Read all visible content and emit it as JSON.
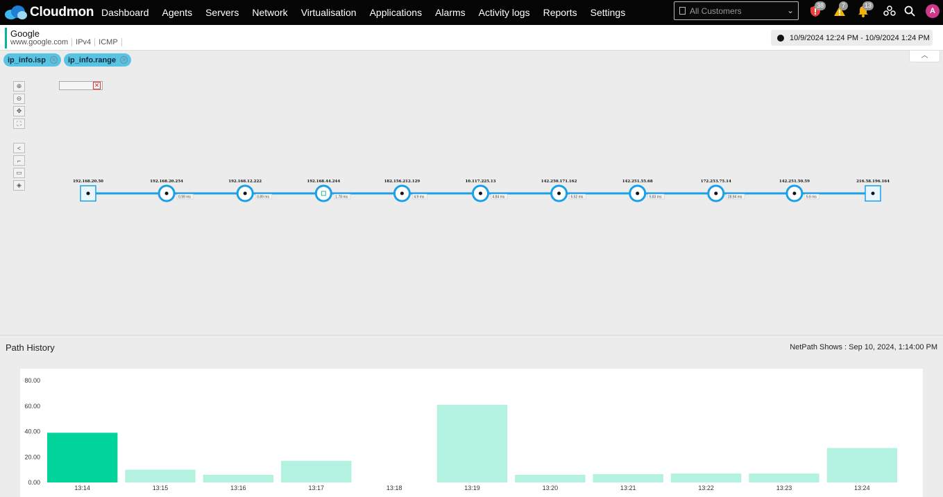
{
  "app": {
    "name": "Cloudmon",
    "nav": [
      "Dashboard",
      "Agents",
      "Servers",
      "Network",
      "Virtualisation",
      "Applications",
      "Alarms",
      "Activity logs",
      "Reports",
      "Settings"
    ],
    "customer_placeholder": "All Customers",
    "badges": {
      "security": "38",
      "warnings": "7",
      "notifications": "13"
    },
    "avatar": "A",
    "icons": [
      "cloud-logo-icon",
      "building-icon",
      "chevron-down-icon",
      "shield-alert-icon",
      "warning-icon",
      "bell-icon",
      "integrations-icon",
      "search-icon"
    ]
  },
  "header": {
    "title": "Google",
    "host": "www.google.com",
    "ip_version": "IPv4",
    "protocol": "ICMP",
    "time_range": "10/9/2024 12:24 PM - 10/9/2024 1:24 PM"
  },
  "filters": [
    {
      "label": "ip_info.isp"
    },
    {
      "label": "ip_info.range"
    }
  ],
  "toolbar": [
    "zoom-in-icon",
    "zoom-out-icon",
    "pan-icon",
    "fit-icon",
    "share-icon",
    "route-icon",
    "list-icon",
    "layers-icon"
  ],
  "path": {
    "source": "192.168.20.50",
    "destination": "216.58.196.164",
    "hops": [
      {
        "ip": "192.168.20.254",
        "latency": "0.99 ms"
      },
      {
        "ip": "192.168.12.222",
        "latency": "0.89 ms"
      },
      {
        "ip": "192.168.44.244",
        "latency": "1.78 ms"
      },
      {
        "ip": "182.156.212.129",
        "latency": "4.9 ms"
      },
      {
        "ip": "10.117.225.13",
        "latency": "4.84 ms"
      },
      {
        "ip": "142.250.171.162",
        "latency": "5.52 ms"
      },
      {
        "ip": "142.251.55.68",
        "latency": "5.83 ms"
      },
      {
        "ip": "172.253.75.14",
        "latency": "28.94 ms"
      },
      {
        "ip": "142.251.50.59",
        "latency": "5.6 ms"
      }
    ],
    "colors": {
      "line": "#1aa0e6",
      "node_fill": "#ffffff"
    }
  },
  "history": {
    "title": "Path History",
    "shows_label": "NetPath Shows : Sep 10, 2024, 1:14:00 PM"
  },
  "chart_data": {
    "type": "bar",
    "categories": [
      "13:14",
      "13:15",
      "13:16",
      "13:17",
      "13:18",
      "13:19",
      "13:20",
      "13:21",
      "13:22",
      "13:23",
      "13:24"
    ],
    "values": [
      39,
      10,
      6,
      17,
      0,
      61,
      6,
      6.5,
      7,
      7,
      27
    ],
    "ylim": [
      0,
      80
    ],
    "yticks": [
      "0.00",
      "20.00",
      "40.00",
      "60.00",
      "80.00"
    ],
    "selected_index": 0,
    "colors": {
      "selected": "#00d49a",
      "normal": "#b3f2e1"
    }
  }
}
